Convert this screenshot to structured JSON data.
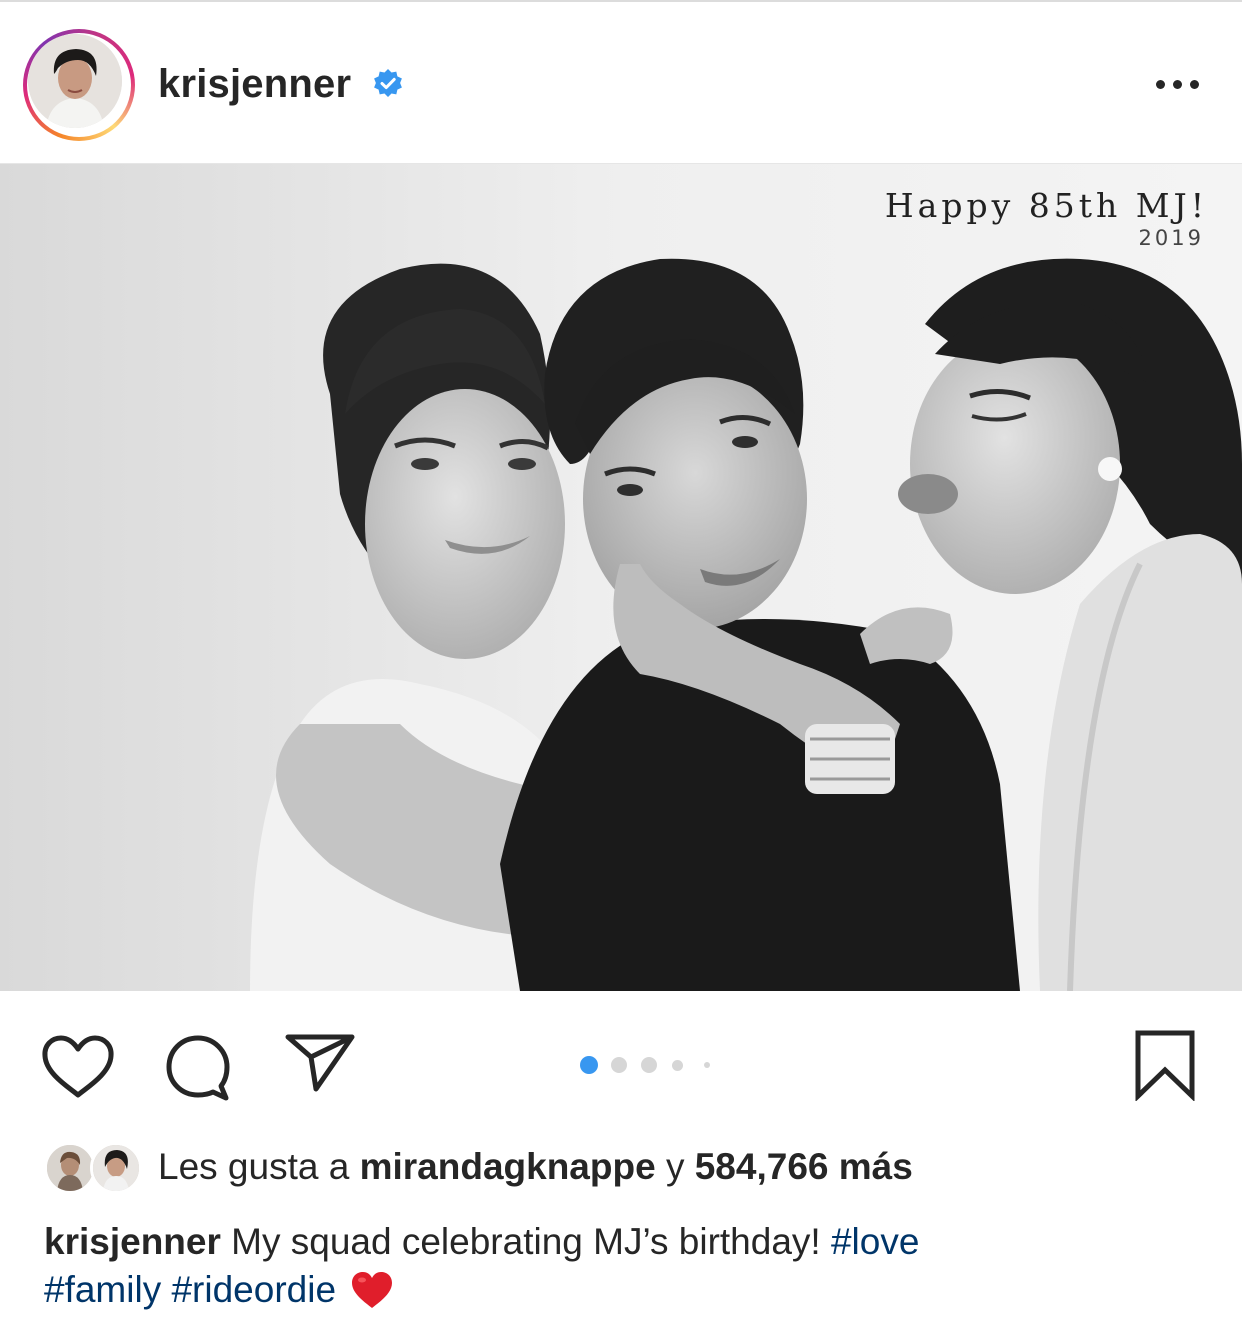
{
  "post": {
    "username": "krisjenner",
    "verified": true,
    "more_icon": "more-horizontal-icon"
  },
  "photo": {
    "overlay_title": "Happy 85th MJ!",
    "overlay_year": "2019",
    "carousel_total": 5,
    "carousel_active": 1
  },
  "actions": {
    "like_icon": "heart-outline-icon",
    "comment_icon": "comment-bubble-icon",
    "share_icon": "paper-plane-icon",
    "save_icon": "bookmark-icon"
  },
  "likes": {
    "prefix": "Les gusta a",
    "liker": "mirandagknappe",
    "connector": "y",
    "count": "584,766 más"
  },
  "caption": {
    "username": "krisjenner",
    "text": "My squad celebrating MJ’s birthday!",
    "hashtags": [
      "#love",
      "#family",
      "#rideordie"
    ],
    "emoji": "red-heart-emoji"
  },
  "colors": {
    "verified_blue": "#3897f0",
    "hashtag_blue": "#003569",
    "pager_active": "#3897f0",
    "pager_inactive": "#d6d6d6"
  }
}
